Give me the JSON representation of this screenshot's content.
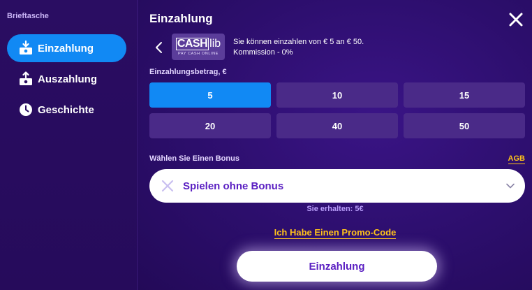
{
  "sidebar": {
    "title": "Brieftasche",
    "items": [
      {
        "label": "Einzahlung",
        "icon": "deposit-icon",
        "active": true
      },
      {
        "label": "Auszahlung",
        "icon": "withdraw-icon",
        "active": false
      },
      {
        "label": "Geschichte",
        "icon": "clock-icon",
        "active": false
      }
    ]
  },
  "header": {
    "title": "Einzahlung"
  },
  "method": {
    "logo_text_main": "CASH",
    "logo_text_lib": "lib",
    "logo_text_sub": "PAY CASH ONLINE",
    "limits_text": "Sie können einzahlen von € 5 an € 50.",
    "commission_text": "Kommission - 0%"
  },
  "amount": {
    "label": "Einzahlungsbetrag, €",
    "options": [
      "5",
      "10",
      "15",
      "20",
      "40",
      "50"
    ],
    "selected": "5"
  },
  "bonus": {
    "label": "Wählen Sie Einen Bonus",
    "agb": "AGB",
    "selected_text": "Spielen ohne Bonus"
  },
  "receive": {
    "text": "Sie erhalten: 5€"
  },
  "promo": {
    "text": "Ich Habe Einen Promo-Code"
  },
  "submit": {
    "label": "Einzahlung"
  },
  "colors": {
    "accent_blue": "#1189f4",
    "link_yellow": "#ffc21a",
    "brand_purple": "#5a1fc2",
    "bg_purple": "#2c0e6c"
  }
}
